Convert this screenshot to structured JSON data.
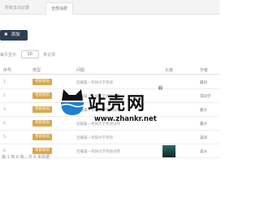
{
  "topbar": {
    "tabs": [
      {
        "label": "所有支出记录"
      },
      {
        "label": "全部消费"
      }
    ]
  },
  "toolbar": {
    "add_label": "添加",
    "add_icon": "close-icon"
  },
  "pager": {
    "prefix": "每页显示",
    "page_size": "10",
    "suffix": "条记录"
  },
  "table": {
    "headers": [
      "序号",
      "类型",
      "问题",
      "头像",
      "作者"
    ],
    "rows": [
      {
        "id": "1",
        "badge": "考研资讯",
        "title": "连载篇—考研大学英语",
        "has_thumb": false,
        "author": "最初"
      },
      {
        "id": "2",
        "badge": "考研资讯",
        "title": "连载篇—考研大学英语试卷",
        "has_thumb": false,
        "author": "李同学"
      },
      {
        "id": "3",
        "badge": "考研资讯",
        "title": "连载篇—考研大学英语试卷",
        "has_thumb": false,
        "author": "最大"
      },
      {
        "id": "4",
        "badge": "考研资讯",
        "title": "连载篇—考研大学英语试卷",
        "has_thumb": false,
        "author": "最大"
      },
      {
        "id": "5",
        "badge": "考研资讯",
        "title": "连载篇—考研大学英语",
        "has_thumb": false,
        "author": "美同"
      },
      {
        "id": "6",
        "badge": "考研资讯",
        "title": "连载篇—考研大学英语试卷",
        "has_thumb": true,
        "author": "美分"
      }
    ]
  },
  "footer": {
    "text": "第 1 到 6 条，共 6 条数据"
  },
  "watermark": {
    "text": "站壳网",
    "mark": "®",
    "url": "www.zhankr.net"
  },
  "colors": {
    "dark_button": "#2e3e4f",
    "badge": "#d9a84e",
    "watermark_blue": "#1f7fd0"
  }
}
